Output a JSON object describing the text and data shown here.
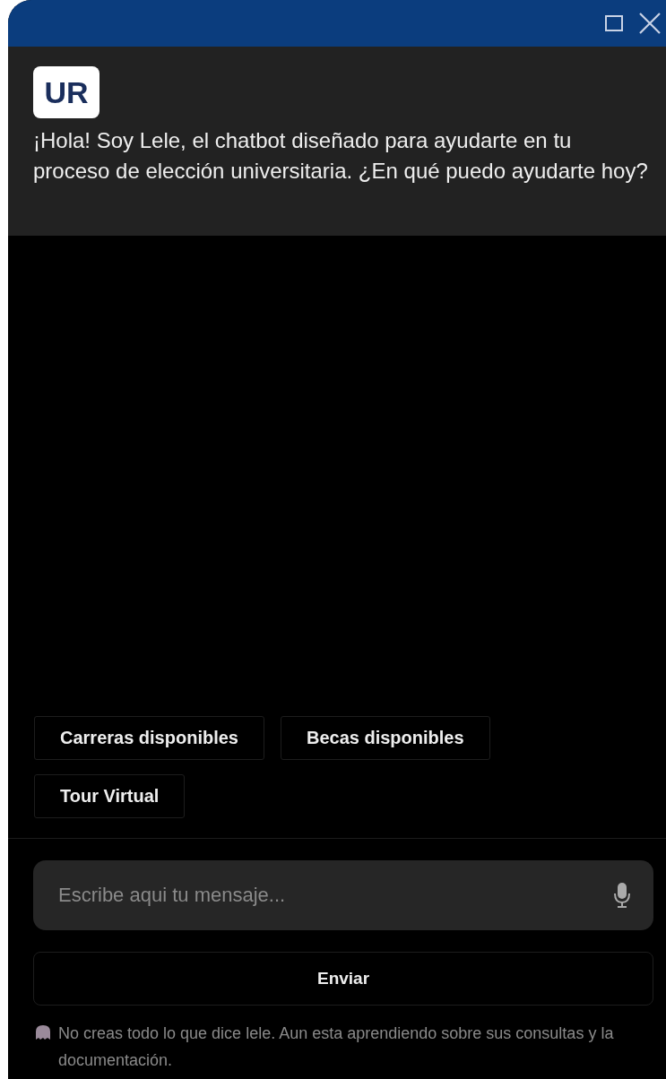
{
  "header": {
    "logo": "UR",
    "greeting": "¡Hola! Soy Lele, el chatbot diseñado para ayudarte en tu proceso de elección universitaria. ¿En qué puedo ayudarte hoy?"
  },
  "suggestions": [
    "Carreras disponibles",
    "Becas disponibles",
    "Tour Virtual"
  ],
  "composer": {
    "placeholder": "Escribe aqui tu mensaje...",
    "send": "Enviar"
  },
  "disclaimer": "No creas todo lo que dice lele. Aun esta aprendiendo sobre sus consultas y la documentación."
}
